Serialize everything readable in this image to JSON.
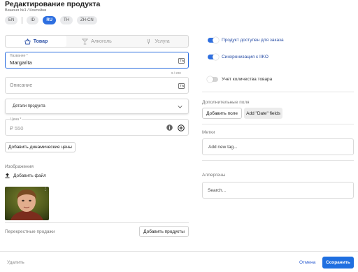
{
  "header": {
    "title": "Редактирование продукта",
    "breadcrumb": "Вишоня №1 / Контейни"
  },
  "languages": [
    "EN",
    "ID",
    "RU",
    "TH",
    "ZH-CN"
  ],
  "active_language": "RU",
  "tabs": [
    {
      "label": "Товар",
      "icon": "basket-icon"
    },
    {
      "label": "Алкоголь",
      "icon": "cocktail-icon"
    },
    {
      "label": "Услуга",
      "icon": "service-icon"
    }
  ],
  "form": {
    "name_label": "Название *",
    "name_value": "Margarita",
    "name_counter": "9 / 200",
    "description_placeholder": "Описание",
    "details_label": "Детали продукта",
    "price_label": "Цена *",
    "price_placeholder": "₽ 550",
    "dynamic_prices_button": "Добавить динамические цены",
    "images_label": "Изображения",
    "add_file_label": "Добавить файл",
    "cross_sales_label": "Перекрестные продажи",
    "add_products_button": "Добавить продукты"
  },
  "settings": {
    "toggles": [
      {
        "label": "Продукт доступен для заказа",
        "on": true
      },
      {
        "label": "Синхронизация с IIKO",
        "on": true
      },
      {
        "label": "Учет количества товара",
        "on": false
      }
    ],
    "extra_fields_label": "Дополнительные поля",
    "add_field_button": "Добавить поле",
    "add_date_fields_button": "Add \"Date\" fields",
    "tags_label": "Метки",
    "tags_placeholder": "Add new tag...",
    "allergens_label": "Аллергены",
    "allergens_placeholder": "Search..."
  },
  "footer": {
    "delete_label": "Удалить",
    "cancel_label": "Отмена",
    "save_label": "Сохранить"
  },
  "colors": {
    "accent": "#2e6fe0",
    "toggle_on": "#2e6fe0",
    "primary_button": "#1f6fe0"
  }
}
